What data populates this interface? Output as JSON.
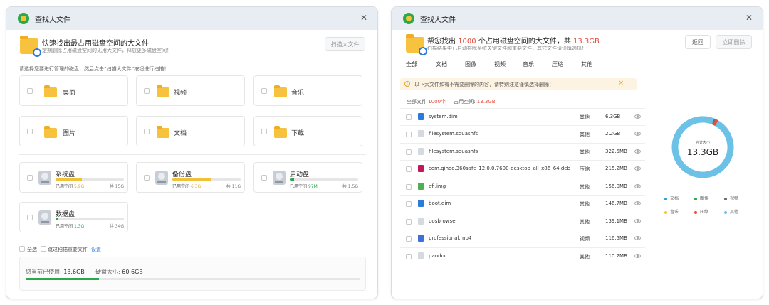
{
  "left": {
    "title": "查找大文件",
    "header": {
      "title": "快速找出最占用磁盘空间的大文件",
      "subtitle": "定期删除占用磁盘空间的无用大文件，释放更多磁盘空间！",
      "scan_button": "扫描大文件"
    },
    "hint": "请选择您要进行管理的磁盘，然后点击“扫描大文件”按钮进行扫描！",
    "categories": [
      "桌面",
      "视频",
      "音乐",
      "图片",
      "文档",
      "下载"
    ],
    "disks": [
      {
        "name": "系统盘",
        "used_label": "已用空间",
        "used": "5.9G",
        "total": "共 15G",
        "fill": 0.39,
        "used_color": "#e8a323"
      },
      {
        "name": "备份盘",
        "used_label": "已用空间",
        "used": "6.3G",
        "total": "共 11G",
        "fill": 0.57,
        "used_color": "#e8a323"
      },
      {
        "name": "启动盘",
        "used_label": "已用空间",
        "used": "97M",
        "total": "共 1.5G",
        "fill": 0.06,
        "used_color": "#2aa84a"
      },
      {
        "name": "数据盘",
        "used_label": "已用空间",
        "used": "1.3G",
        "total": "共 34G",
        "fill": 0.04,
        "used_color": "#2aa84a"
      }
    ],
    "select_all": "全选",
    "skip_important": "跳过扫描重要文件",
    "settings_link": "设置",
    "usage": {
      "current_label": "您当前已使用:",
      "current_value": "13.6GB",
      "total_label": "硬盘大小:",
      "total_value": "60.6GB",
      "fill": 0.22
    }
  },
  "right": {
    "title": "查找大文件",
    "header": {
      "title_prefix": "帮您找出",
      "count": "1000",
      "title_mid": "个占用磁盘空间的大文件，共",
      "total": "13.3GB",
      "subtitle": "扫描结果中已自动排除系统关键文件和重要文件，其它文件请谨慎选择！",
      "back_button": "返回",
      "delete_button": "立即删除"
    },
    "tabs": [
      "全部",
      "文档",
      "图像",
      "视频",
      "音乐",
      "压缩",
      "其他"
    ],
    "notice": "以下大文件如有不需要删除的内容，请特别注意谨慎选择删除：",
    "summary": {
      "all_label": "全部文件",
      "all_value": "1000个",
      "space_label": "占用空间:",
      "space_value": "13.3GB"
    },
    "files": [
      {
        "name": "system.dim",
        "type": "其他",
        "size": "6.3GB",
        "icon_color": "#2d7bd8"
      },
      {
        "name": "filesystem.squashfs",
        "type": "其他",
        "size": "2.2GB",
        "icon_color": "#d5d9e0"
      },
      {
        "name": "filesystem.squashfs",
        "type": "其他",
        "size": "322.5MB",
        "icon_color": "#d5d9e0"
      },
      {
        "name": "com.qihoo.360safe_12.0.0.7600-desktop_all_x86_64.deb",
        "type": "压缩",
        "size": "215.2MB",
        "icon_color": "#c2185b"
      },
      {
        "name": "efi.img",
        "type": "其他",
        "size": "156.0MB",
        "icon_color": "#4caf50"
      },
      {
        "name": "boot.dim",
        "type": "其他",
        "size": "146.7MB",
        "icon_color": "#2d7bd8"
      },
      {
        "name": "uosbrowser",
        "type": "其他",
        "size": "139.1MB",
        "icon_color": "#d5d9e0"
      },
      {
        "name": "professional.mp4",
        "type": "视频",
        "size": "116.5MB",
        "icon_color": "#3f6fd8"
      },
      {
        "name": "pandoc",
        "type": "其他",
        "size": "110.2MB",
        "icon_color": "#d5d9e0"
      }
    ],
    "donut": {
      "label": "合计大小",
      "value": "13.3GB",
      "segments": [
        {
          "name": "文档",
          "fraction": 0.0,
          "color": "#2a9fd8"
        },
        {
          "name": "图像",
          "fraction": 0.0,
          "color": "#2aa84a"
        },
        {
          "name": "视频",
          "fraction": 0.009,
          "color": "#6b6b6b"
        },
        {
          "name": "音乐",
          "fraction": 0.0,
          "color": "#f2c13b"
        },
        {
          "name": "压缩",
          "fraction": 0.016,
          "color": "#e74c3c"
        },
        {
          "name": "其他",
          "fraction": 0.975,
          "color": "#6cc2e6"
        }
      ]
    }
  }
}
